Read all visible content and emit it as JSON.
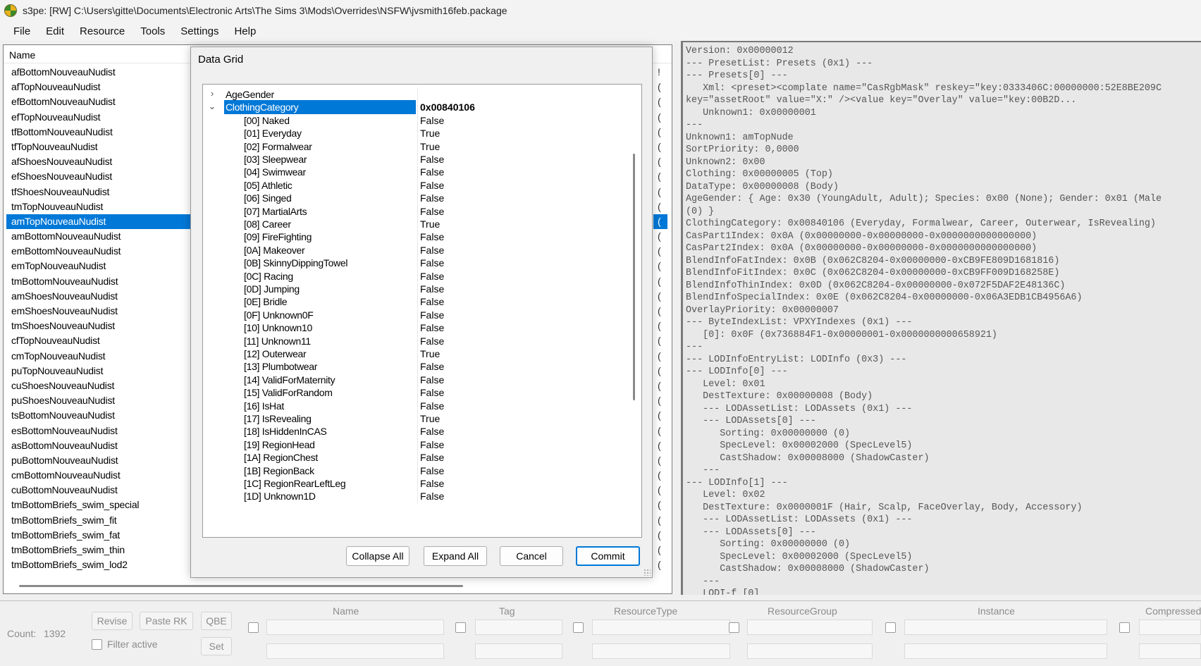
{
  "window": {
    "title": "s3pe: [RW] C:\\Users\\gitte\\Documents\\Electronic Arts\\The Sims 3\\Mods\\Overrides\\NSFW\\jvsmith16feb.package"
  },
  "menu": [
    "File",
    "Edit",
    "Resource",
    "Tools",
    "Settings",
    "Help"
  ],
  "list": {
    "header": "Name",
    "selected_index": 10,
    "items": [
      "afBottomNouveauNudist",
      "afTopNouveauNudist",
      "efBottomNouveauNudist",
      "efTopNouveauNudist",
      "tfBottomNouveauNudist",
      "tfTopNouveauNudist",
      "afShoesNouveauNudist",
      "efShoesNouveauNudist",
      "tfShoesNouveauNudist",
      "tmTopNouveauNudist",
      "amTopNouveauNudist",
      "amBottomNouveauNudist",
      "emBottomNouveauNudist",
      "emTopNouveauNudist",
      "tmBottomNouveauNudist",
      "amShoesNouveauNudist",
      "emShoesNouveauNudist",
      "tmShoesNouveauNudist",
      "cfTopNouveauNudist",
      "cmTopNouveauNudist",
      "puTopNouveauNudist",
      "cuShoesNouveauNudist",
      "puShoesNouveauNudist",
      "tsBottomNouveauNudist",
      "esBottomNouveauNudist",
      "asBottomNouveauNudist",
      "puBottomNouveauNudist",
      "cmBottomNouveauNudist",
      "cuBottomNouveauNudist",
      "tmBottomBriefs_swim_special",
      "tmBottomBriefs_swim_fit",
      "tmBottomBriefs_swim_fat",
      "tmBottomBriefs_swim_thin",
      "tmBottomBriefs_swim_lod2"
    ],
    "right_marks_first": "!",
    "right_marks": "("
  },
  "dialog": {
    "title": "Data Grid",
    "rows": [
      {
        "expander": ">",
        "key": "AgeGender",
        "value": "",
        "child": false
      },
      {
        "expander": "v",
        "key": "ClothingCategory",
        "value": "0x00840106",
        "child": false,
        "selected": true
      },
      {
        "key": "[00] Naked",
        "value": "False",
        "child": true
      },
      {
        "key": "[01] Everyday",
        "value": "True",
        "child": true
      },
      {
        "key": "[02] Formalwear",
        "value": "True",
        "child": true
      },
      {
        "key": "[03] Sleepwear",
        "value": "False",
        "child": true
      },
      {
        "key": "[04] Swimwear",
        "value": "False",
        "child": true
      },
      {
        "key": "[05] Athletic",
        "value": "False",
        "child": true
      },
      {
        "key": "[06] Singed",
        "value": "False",
        "child": true
      },
      {
        "key": "[07] MartialArts",
        "value": "False",
        "child": true
      },
      {
        "key": "[08] Career",
        "value": "True",
        "child": true
      },
      {
        "key": "[09] FireFighting",
        "value": "False",
        "child": true
      },
      {
        "key": "[0A] Makeover",
        "value": "False",
        "child": true
      },
      {
        "key": "[0B] SkinnyDippingTowel",
        "value": "False",
        "child": true
      },
      {
        "key": "[0C] Racing",
        "value": "False",
        "child": true
      },
      {
        "key": "[0D] Jumping",
        "value": "False",
        "child": true
      },
      {
        "key": "[0E] Bridle",
        "value": "False",
        "child": true
      },
      {
        "key": "[0F] Unknown0F",
        "value": "False",
        "child": true
      },
      {
        "key": "[10] Unknown10",
        "value": "False",
        "child": true
      },
      {
        "key": "[11] Unknown11",
        "value": "False",
        "child": true
      },
      {
        "key": "[12] Outerwear",
        "value": "True",
        "child": true
      },
      {
        "key": "[13] Plumbotwear",
        "value": "False",
        "child": true
      },
      {
        "key": "[14] ValidForMaternity",
        "value": "False",
        "child": true
      },
      {
        "key": "[15] ValidForRandom",
        "value": "False",
        "child": true
      },
      {
        "key": "[16] IsHat",
        "value": "False",
        "child": true
      },
      {
        "key": "[17] IsRevealing",
        "value": "True",
        "child": true
      },
      {
        "key": "[18] IsHiddenInCAS",
        "value": "False",
        "child": true
      },
      {
        "key": "[19] RegionHead",
        "value": "False",
        "child": true
      },
      {
        "key": "[1A] RegionChest",
        "value": "False",
        "child": true
      },
      {
        "key": "[1B] RegionBack",
        "value": "False",
        "child": true
      },
      {
        "key": "[1C] RegionRearLeftLeg",
        "value": "False",
        "child": true
      },
      {
        "key": "[1D] Unknown1D",
        "value": "False",
        "child": true
      }
    ],
    "buttons": {
      "collapse_all": "Collapse All",
      "expand_all": "Expand All",
      "cancel": "Cancel",
      "commit": "Commit"
    }
  },
  "detail_lines": [
    "Version: 0x00000012",
    "--- PresetList: Presets (0x1) ---",
    "--- Presets[0] ---",
    "   Xml: <preset><complate name=\"CasRgbMask\" reskey=\"key:0333406C:00000000:52E8BE209C",
    "key=\"assetRoot\" value=\"X:\" /><value key=\"Overlay\" value=\"key:00B2D...",
    "   Unknown1: 0x00000001",
    "---",
    "Unknown1: amTopNude",
    "SortPriority: 0,0000",
    "Unknown2: 0x00",
    "Clothing: 0x00000005 (Top)",
    "DataType: 0x00000008 (Body)",
    "AgeGender: { Age: 0x30 (YoungAdult, Adult); Species: 0x00 (None); Gender: 0x01 (Male",
    "(0) }",
    "ClothingCategory: 0x00840106 (Everyday, Formalwear, Career, Outerwear, IsRevealing)",
    "CasPart1Index: 0x0A (0x00000000-0x00000000-0x0000000000000000)",
    "CasPart2Index: 0x0A (0x00000000-0x00000000-0x0000000000000000)",
    "BlendInfoFatIndex: 0x0B (0x062C8204-0x00000000-0xCB9FE809D1681816)",
    "BlendInfoFitIndex: 0x0C (0x062C8204-0x00000000-0xCB9FF009D168258E)",
    "BlendInfoThinIndex: 0x0D (0x062C8204-0x00000000-0x072F5DAF2E48136C)",
    "BlendInfoSpecialIndex: 0x0E (0x062C8204-0x00000000-0x06A3EDB1CB4956A6)",
    "OverlayPriority: 0x00000007",
    "--- ByteIndexList: VPXYIndexes (0x1) ---",
    "   [0]: 0x0F (0x736884F1-0x00000001-0x0000000000658921)",
    "---",
    "--- LODInfoEntryList: LODInfo (0x3) ---",
    "--- LODInfo[0] ---",
    "   Level: 0x01",
    "   DestTexture: 0x00000008 (Body)",
    "   --- LODAssetList: LODAssets (0x1) ---",
    "   --- LODAssets[0] ---",
    "      Sorting: 0x00000000 (0)",
    "      SpecLevel: 0x00002000 (SpecLevel5)",
    "      CastShadow: 0x00008000 (ShadowCaster)",
    "   ---",
    "--- LODInfo[1] ---",
    "   Level: 0x02",
    "   DestTexture: 0x0000001F (Hair, Scalp, FaceOverlay, Body, Accessory)",
    "   --- LODAssetList: LODAssets (0x1) ---",
    "   --- LODAssets[0] ---",
    "      Sorting: 0x00000000 (0)",
    "      SpecLevel: 0x00002000 (SpecLevel5)",
    "      CastShadow: 0x00008000 (ShadowCaster)",
    "   ---",
    "   LODI-f [0]"
  ],
  "bottom": {
    "count_label": "Count:",
    "count_value": "1392",
    "revise": "Revise",
    "paste_rk": "Paste RK",
    "qbe": "QBE",
    "filter_active": "Filter active",
    "set": "Set",
    "columns": [
      "Name",
      "Tag",
      "ResourceType",
      "ResourceGroup",
      "Instance",
      "Compressed"
    ]
  }
}
